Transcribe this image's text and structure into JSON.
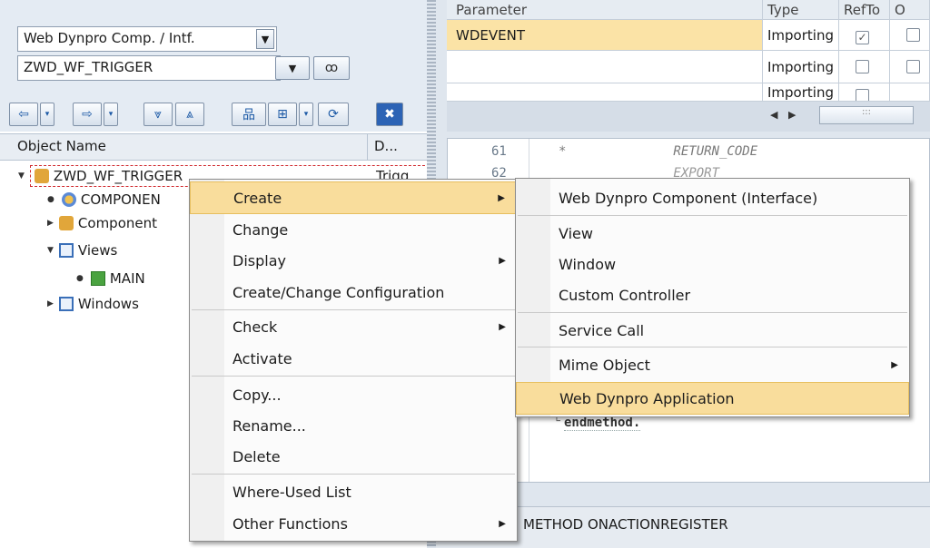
{
  "left": {
    "type_combo": "Web Dynpro Comp. / Intf.",
    "object_combo": "ZWD_WF_TRIGGER",
    "toolbar_icons": [
      "back-arrow-icon",
      "forward-arrow-icon",
      "expand-all-icon",
      "collapse-all-icon",
      "hierarchy-icon",
      "display-object-icon",
      "refresh-icon",
      "close-window-icon"
    ],
    "tree_header": {
      "col1": "Object Name",
      "col2": "D..."
    },
    "tree": {
      "root": "ZWD_WF_TRIGGER",
      "root_desc": "Trigg",
      "componentcontroller": "COMPONEN",
      "component_interface": "Component",
      "views": "Views",
      "main": "MAIN",
      "windows": "Windows"
    }
  },
  "params": {
    "headers": [
      "Parameter",
      "Type",
      "RefTo",
      "O"
    ],
    "rows": [
      {
        "name": "WDEVENT",
        "type": "Importing",
        "refto": true
      },
      {
        "name": "",
        "type": "Importing",
        "refto": false
      },
      {
        "name": "",
        "type": "Importing",
        "refto": false
      }
    ],
    "scroll_grip": ":::"
  },
  "editor": {
    "line_numbers": [
      "61",
      "62"
    ],
    "line61": "*              RETURN_CODE",
    "line62_partial": "               EXPORT",
    "endmethod": "endmethod."
  },
  "status": {
    "text": "METHOD ONACTIONREGISTER"
  },
  "context_menu": {
    "items": [
      {
        "label": "Create",
        "submenu": true,
        "highlighted": true
      },
      {
        "label": "Change"
      },
      {
        "label": "Display",
        "submenu": true
      },
      {
        "label": "Create/Change Configuration"
      },
      {
        "label": "Check",
        "submenu": true
      },
      {
        "label": "Activate"
      },
      {
        "label": "Copy..."
      },
      {
        "label": "Rename..."
      },
      {
        "label": "Delete"
      },
      {
        "label": "Where-Used List"
      },
      {
        "label": "Other Functions",
        "submenu": true
      }
    ]
  },
  "submenu": {
    "items": [
      {
        "label": "Web Dynpro Component (Interface)"
      },
      {
        "label": "View"
      },
      {
        "label": "Window"
      },
      {
        "label": "Custom Controller"
      },
      {
        "label": "Service Call"
      },
      {
        "label": "Mime Object",
        "submenu": true
      },
      {
        "label": "Web Dynpro Application",
        "highlighted": true
      }
    ]
  },
  "colors": {
    "highlight": "#f9dd9c",
    "selected_row": "#fbe3a6",
    "background": "#dfe6ee"
  }
}
